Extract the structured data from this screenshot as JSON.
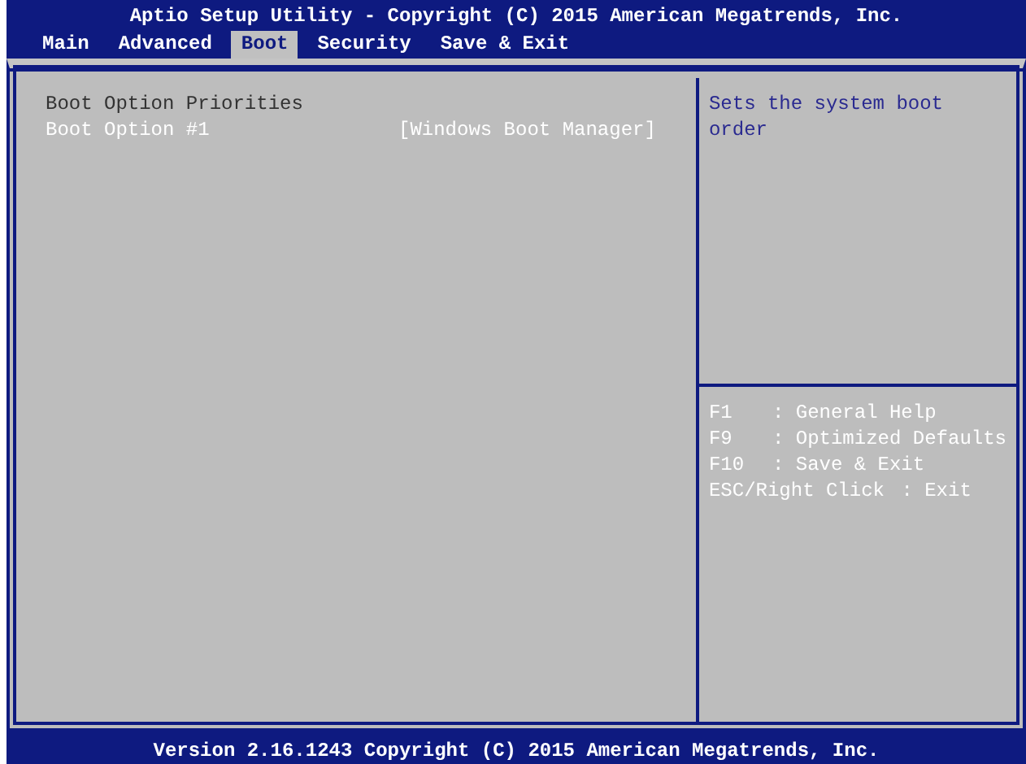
{
  "window": {
    "title": "Aptio Setup Utility - Copyright (C) 2015 American Megatrends, Inc."
  },
  "tabs": [
    {
      "label": "Main",
      "selected": false
    },
    {
      "label": "Advanced",
      "selected": false
    },
    {
      "label": "Boot",
      "selected": true
    },
    {
      "label": "Security",
      "selected": false
    },
    {
      "label": "Save & Exit",
      "selected": false
    }
  ],
  "settings": [
    {
      "kind": "heading",
      "label": "Boot Option Priorities"
    },
    {
      "kind": "option",
      "label": "Boot Option #1",
      "value": "[Windows Boot Manager]"
    }
  ],
  "help_text": "Sets the system boot order",
  "hotkeys": [
    {
      "key": "F1",
      "description": ": General Help"
    },
    {
      "key": "F9",
      "description": ": Optimized Defaults"
    },
    {
      "key": "F10",
      "description": ": Save & Exit"
    },
    {
      "key": "ESC/Right Click",
      "description": ": Exit"
    }
  ],
  "status_bar": "Version 2.16.1243 Copyright (C) 2015 American Megatrends, Inc."
}
